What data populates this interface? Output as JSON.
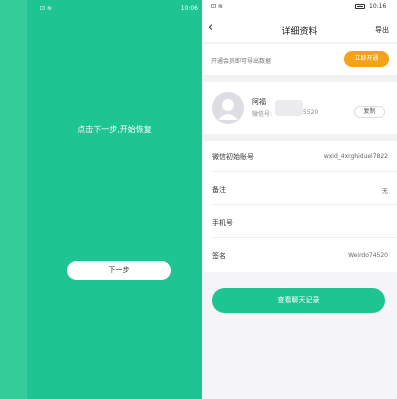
{
  "left_panel": {
    "status_bar": {
      "icons": "⊡ ≋",
      "time": "10:06"
    },
    "prompt": "点击下一步,开始恢复",
    "next_button": "下一步",
    "colors": {
      "background": "#1ec492",
      "strip": "#34cc98"
    }
  },
  "right_panel": {
    "status_bar": {
      "icons": "⊡ ≋",
      "time": "10:16"
    },
    "nav": {
      "back_icon": "‹",
      "title": "详细资料",
      "export_label": "导出"
    },
    "member_banner": {
      "text": "开通会员即可导出数据",
      "button": "立即开通",
      "button_color": "#f6a11a"
    },
    "profile": {
      "nickname": "阿福",
      "wxid_label": "微信号:",
      "wxid_visible_tail": "5520",
      "copy_button": "复制"
    },
    "info_rows": [
      {
        "label": "微信初始账号",
        "value": "wxid_4xrghiduel7822"
      },
      {
        "label": "备注",
        "value": "无"
      },
      {
        "label": "手机号",
        "value": ""
      },
      {
        "label": "签名",
        "value": "Weirdo74520"
      }
    ],
    "chat_button": "查看聊天记录",
    "accent_color": "#1ec492"
  }
}
